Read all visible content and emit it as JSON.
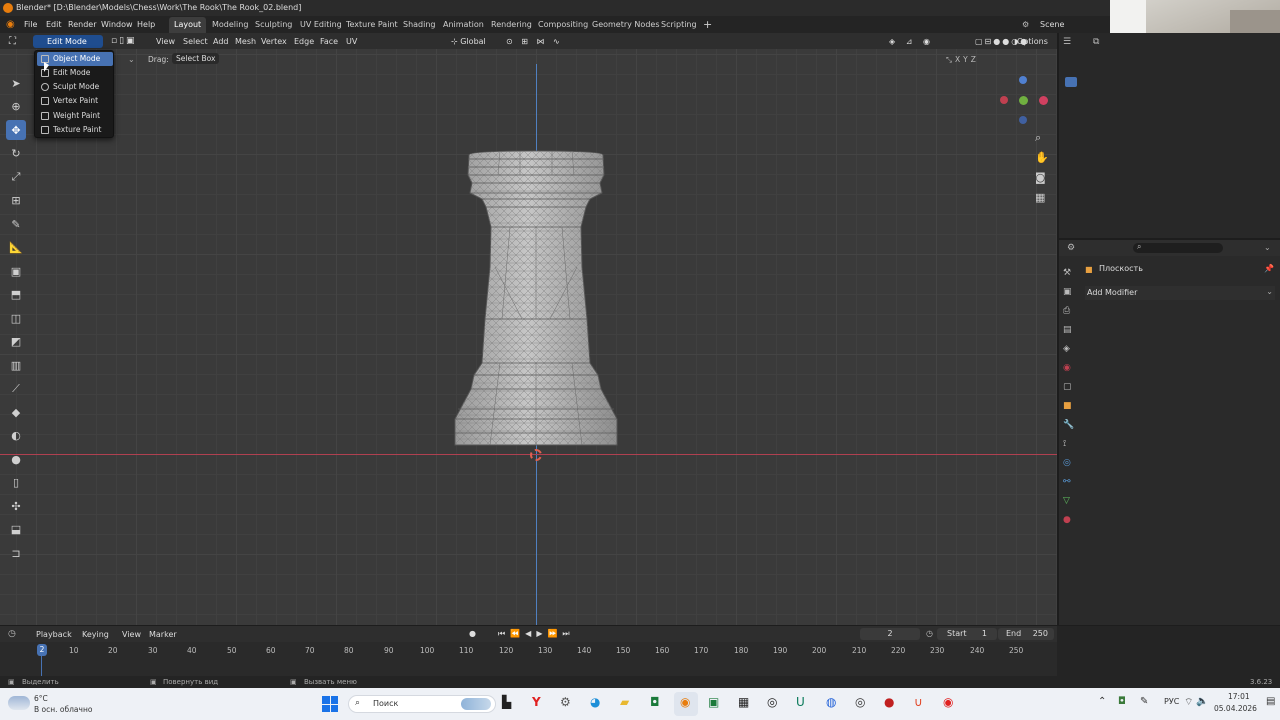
{
  "window_title": "Blender* [D:\\Blender\\Models\\Chess\\Work\\The Rook\\The Rook_02.blend]",
  "menu": [
    "File",
    "Edit",
    "Render",
    "Window",
    "Help"
  ],
  "workspaces": [
    "Layout",
    "Modeling",
    "Sculpting",
    "UV Editing",
    "Texture Paint",
    "Shading",
    "Animation",
    "Rendering",
    "Compositing",
    "Geometry Nodes",
    "Scripting"
  ],
  "active_workspace": "Layout",
  "scene_name": "Scene",
  "header": {
    "mode": "Edit Mode",
    "view_menus": [
      "View",
      "Select",
      "Add",
      "Mesh",
      "Vertex",
      "Edge",
      "Face",
      "UV"
    ],
    "orientation": "Global",
    "options": "Options",
    "drag_label": "Drag:",
    "drag_value": "Select Box"
  },
  "mode_dropdown": {
    "items": [
      "Object Mode",
      "Edit Mode",
      "Sculpt Mode",
      "Vertex Paint",
      "Weight Paint",
      "Texture Paint"
    ],
    "highlighted": "Object Mode"
  },
  "properties": {
    "object_name": "Плоскость",
    "add_modifier": "Add Modifier"
  },
  "timeline": {
    "menus": [
      "Playback",
      "Keying",
      "View",
      "Marker"
    ],
    "current_frame": "2",
    "start_label": "Start",
    "start": "1",
    "end_label": "End",
    "end": "250",
    "ruler": [
      "2",
      "10",
      "20",
      "30",
      "40",
      "50",
      "60",
      "70",
      "80",
      "90",
      "100",
      "110",
      "120",
      "130",
      "140",
      "150",
      "160",
      "170",
      "180",
      "190",
      "200",
      "210",
      "220",
      "230",
      "240",
      "250"
    ]
  },
  "status": {
    "select": "Выделить",
    "rotate": "Повернуть вид",
    "menu": "Вызвать меню",
    "version": "3.6.23"
  },
  "taskbar": {
    "weather_temp": "6°C",
    "weather_desc": "В осн. облачно",
    "search": "Поиск",
    "lang": "РУС",
    "time": "17:01",
    "date": "05.04.2026"
  },
  "colors": {
    "accent": "#4772b3",
    "x_axis": "#b04050",
    "y_axis": "#5080c0",
    "blender_orange": "#e87d0d"
  }
}
